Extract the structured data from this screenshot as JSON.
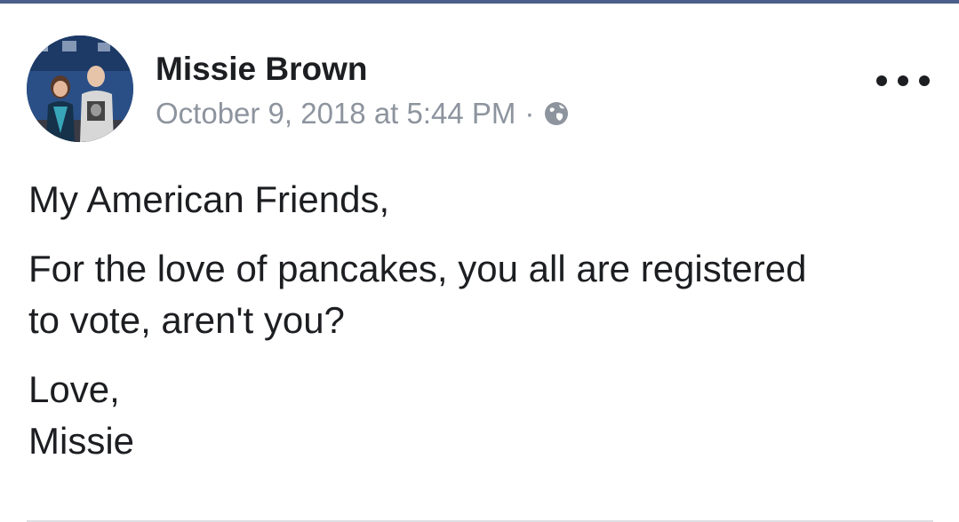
{
  "post": {
    "author": "Missie Brown",
    "timestamp": "October 9, 2018 at 5:44 PM",
    "separator": "·",
    "privacy_icon": "globe-icon",
    "menu_icon": "more-options-icon",
    "paragraphs": [
      "My American Friends,",
      "For the love of pancakes, you all are registered\nto vote, aren't you?",
      "Love,\nMissie"
    ]
  },
  "colors": {
    "top_bar": "#4a5f8a",
    "name": "#1c1e21",
    "meta": "#8d949e",
    "divider": "#dddfe2"
  }
}
